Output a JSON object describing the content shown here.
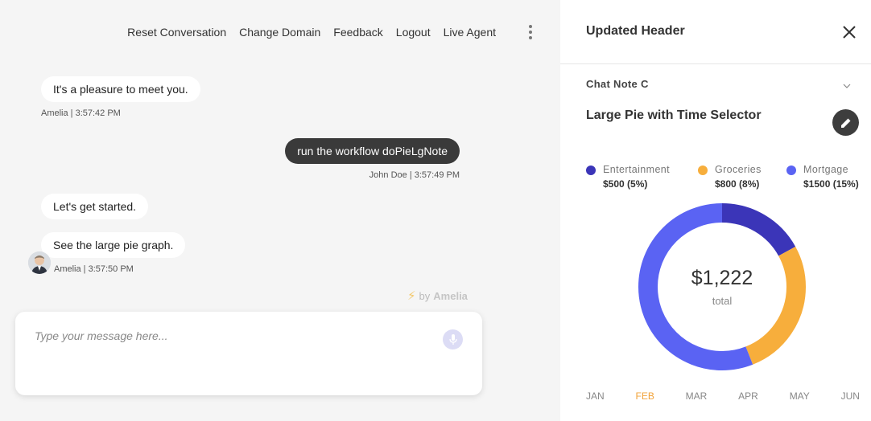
{
  "nav": {
    "items": [
      "Reset Conversation",
      "Change Domain",
      "Feedback",
      "Logout",
      "Live Agent"
    ]
  },
  "messages": [
    {
      "text": "It's a pleasure to meet you.",
      "meta": "Amelia | 3:57:42 PM"
    },
    {
      "text": "run the workflow doPieLgNote",
      "meta": "John Doe | 3:57:49 PM"
    },
    {
      "text": "Let's get started.",
      "meta": ""
    },
    {
      "text": "See the large pie graph.",
      "meta": "Amelia | 3:57:50 PM"
    }
  ],
  "powered": {
    "prefix": "by",
    "brand": "Amelia"
  },
  "composer": {
    "placeholder": "Type your message here..."
  },
  "panel": {
    "title": "Updated Header",
    "note_title": "Chat Note C",
    "chart_title": "Large Pie with Time Selector"
  },
  "chart_data": {
    "type": "pie",
    "title": "Large Pie with Time Selector",
    "center_value": "$1,222",
    "center_label": "total",
    "legend_position": "top",
    "series": [
      {
        "name": "Entertainment",
        "label": "$500 (5%)",
        "share": 0.17,
        "color": "#3b35b8"
      },
      {
        "name": "Groceries",
        "label": "$800 (8%)",
        "share": 0.27,
        "color": "#f7ae3c"
      },
      {
        "name": "Mortgage",
        "label": "$1500 (15%)",
        "share": 0.56,
        "color": "#5a63f3"
      }
    ],
    "months": [
      "JAN",
      "FEB",
      "MAR",
      "APR",
      "MAY",
      "JUN"
    ],
    "selected_month": "FEB"
  }
}
